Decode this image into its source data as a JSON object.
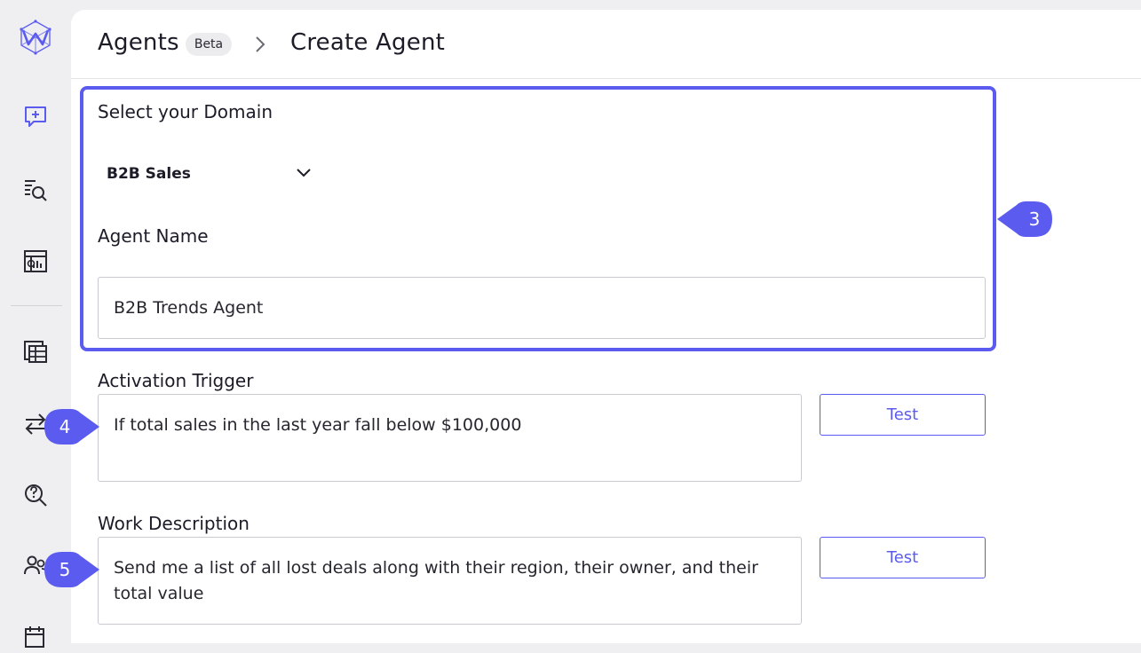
{
  "sidebar": {
    "icons": [
      "logo-icon",
      "new-chat-icon",
      "search-list-icon",
      "report-chart-icon",
      "table-grid-icon",
      "swap-arrows-icon",
      "question-search-icon",
      "users-icon",
      "calendar-clock-icon"
    ]
  },
  "header": {
    "breadcrumb_root": "Agents",
    "badge": "Beta",
    "title": "Create Agent"
  },
  "form": {
    "domain_label": "Select your Domain",
    "domain_value": "B2B Sales",
    "agent_name_label": "Agent Name",
    "agent_name_value": "B2B Trends Agent",
    "trigger_label": "Activation Trigger",
    "trigger_value": "If total sales in the last year fall below $100,000",
    "trigger_test_label": "Test",
    "work_label": "Work Description",
    "work_value": "Send me a list of all lost deals along with their region, their owner, and their total value",
    "work_test_label": "Test"
  },
  "markers": {
    "m3": "3",
    "m4": "4",
    "m5": "5"
  },
  "colors": {
    "accent": "#5b5bf0",
    "background": "#efeff1",
    "panel": "#ffffff"
  }
}
